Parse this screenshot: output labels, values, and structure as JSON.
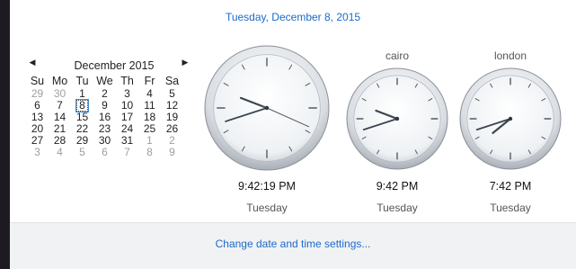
{
  "header": {
    "full_date": "Tuesday, December 8, 2015"
  },
  "calendar": {
    "month_label": "December 2015",
    "prev_icon": "triangle-left-icon",
    "next_icon": "triangle-right-icon",
    "weekdays": [
      "Su",
      "Mo",
      "Tu",
      "We",
      "Th",
      "Fr",
      "Sa"
    ],
    "weeks": [
      [
        "29",
        "30",
        "1",
        "2",
        "3",
        "4",
        "5"
      ],
      [
        "6",
        "7",
        "8",
        "9",
        "10",
        "11",
        "12"
      ],
      [
        "13",
        "14",
        "15",
        "16",
        "17",
        "18",
        "19"
      ],
      [
        "20",
        "21",
        "22",
        "23",
        "24",
        "25",
        "26"
      ],
      [
        "27",
        "28",
        "29",
        "30",
        "31",
        "1",
        "2"
      ],
      [
        "3",
        "4",
        "5",
        "6",
        "7",
        "8",
        "9"
      ]
    ],
    "selected_day": "8"
  },
  "clocks": [
    {
      "label": "",
      "time": "9:42:19 PM",
      "day": "Tuesday",
      "hour": 9,
      "minute": 42,
      "second": 19
    },
    {
      "label": "cairo",
      "time": "9:42 PM",
      "day": "Tuesday",
      "hour": 9,
      "minute": 42
    },
    {
      "label": "london",
      "time": "7:42 PM",
      "day": "Tuesday",
      "hour": 7,
      "minute": 42
    }
  ],
  "footer": {
    "link": "Change date and time settings..."
  },
  "colors": {
    "accent": "#1b6ac9",
    "panel": "#ffffff",
    "footer": "#f1f2f4",
    "background": "#1e1a22"
  }
}
